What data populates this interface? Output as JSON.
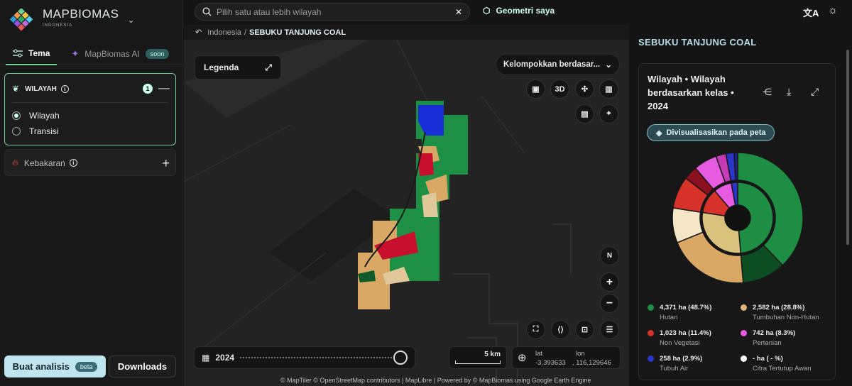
{
  "brand": {
    "name": "MAPBIOMAS",
    "sub": "INDONESIA"
  },
  "tabs": {
    "tema": "Tema",
    "ai": "MapBiomas AI",
    "soon": "soon"
  },
  "wilayah": {
    "title": "WILAYAH",
    "count": "1",
    "opt1": "Wilayah",
    "opt2": "Transisi"
  },
  "kebakaran": {
    "title": "Kebakaran"
  },
  "buttons": {
    "analysis": "Buat analisis",
    "beta": "beta",
    "downloads": "Downloads"
  },
  "search": {
    "placeholder": "Pilih satu atau lebih wilayah"
  },
  "geometry": "Geometri saya",
  "breadcrumb": {
    "root": "Indonesia",
    "sep": "/",
    "current": "SEBUKU TANJUNG COAL"
  },
  "map": {
    "legend": "Legenda",
    "group": "Kelompokkan berdasar...",
    "btn3d": "3D",
    "north": "N",
    "year": "2024",
    "scale": "5 km",
    "lat_label": "lat",
    "lat": "-3,393633",
    "lon_label": "lon",
    "lon": ", 116,129646",
    "attribution": "© MapTiler © OpenStreetMap contributors | MapLibre | Powered by © MapBiomas using Google Earth Engine"
  },
  "panel": {
    "title": "SEBUKU TANJUNG COAL",
    "card_title": "Wilayah • Wilayah berdasarkan kelas • 2024",
    "viz": "Divisualisasikan pada peta"
  },
  "chart_data": {
    "type": "pie",
    "inner": [
      {
        "label": "Hutan",
        "value": 48.7,
        "color": "#1f8e45"
      },
      {
        "label": "Tumbuhan Non-Hutan",
        "value": 28.8,
        "color": "#d9c27c"
      },
      {
        "label": "Non Vegetasi",
        "value": 11.4,
        "color": "#d7322a"
      },
      {
        "label": "Pertanian",
        "value": 8.3,
        "color": "#e65be0"
      },
      {
        "label": "Tubuh Air",
        "value": 2.9,
        "color": "#2a34c8"
      }
    ],
    "legend": [
      {
        "value": "4,371 ha (48.7%)",
        "name": "Hutan",
        "color": "#1f8e45"
      },
      {
        "value": "2,582 ha (28.8%)",
        "name": "Tumbuhan Non-Hutan",
        "color": "#d9b37a"
      },
      {
        "value": "1,023 ha (11.4%)",
        "name": "Non Vegetasi",
        "color": "#d7322a"
      },
      {
        "value": "742 ha (8.3%)",
        "name": "Pertanian",
        "color": "#e65be0"
      },
      {
        "value": "258 ha (2.9%)",
        "name": "Tubuh Air",
        "color": "#2a34c8"
      },
      {
        "value": "- ha ( - %)",
        "name": "Citra Tertutup Awan",
        "color": "#ffffff"
      }
    ]
  }
}
